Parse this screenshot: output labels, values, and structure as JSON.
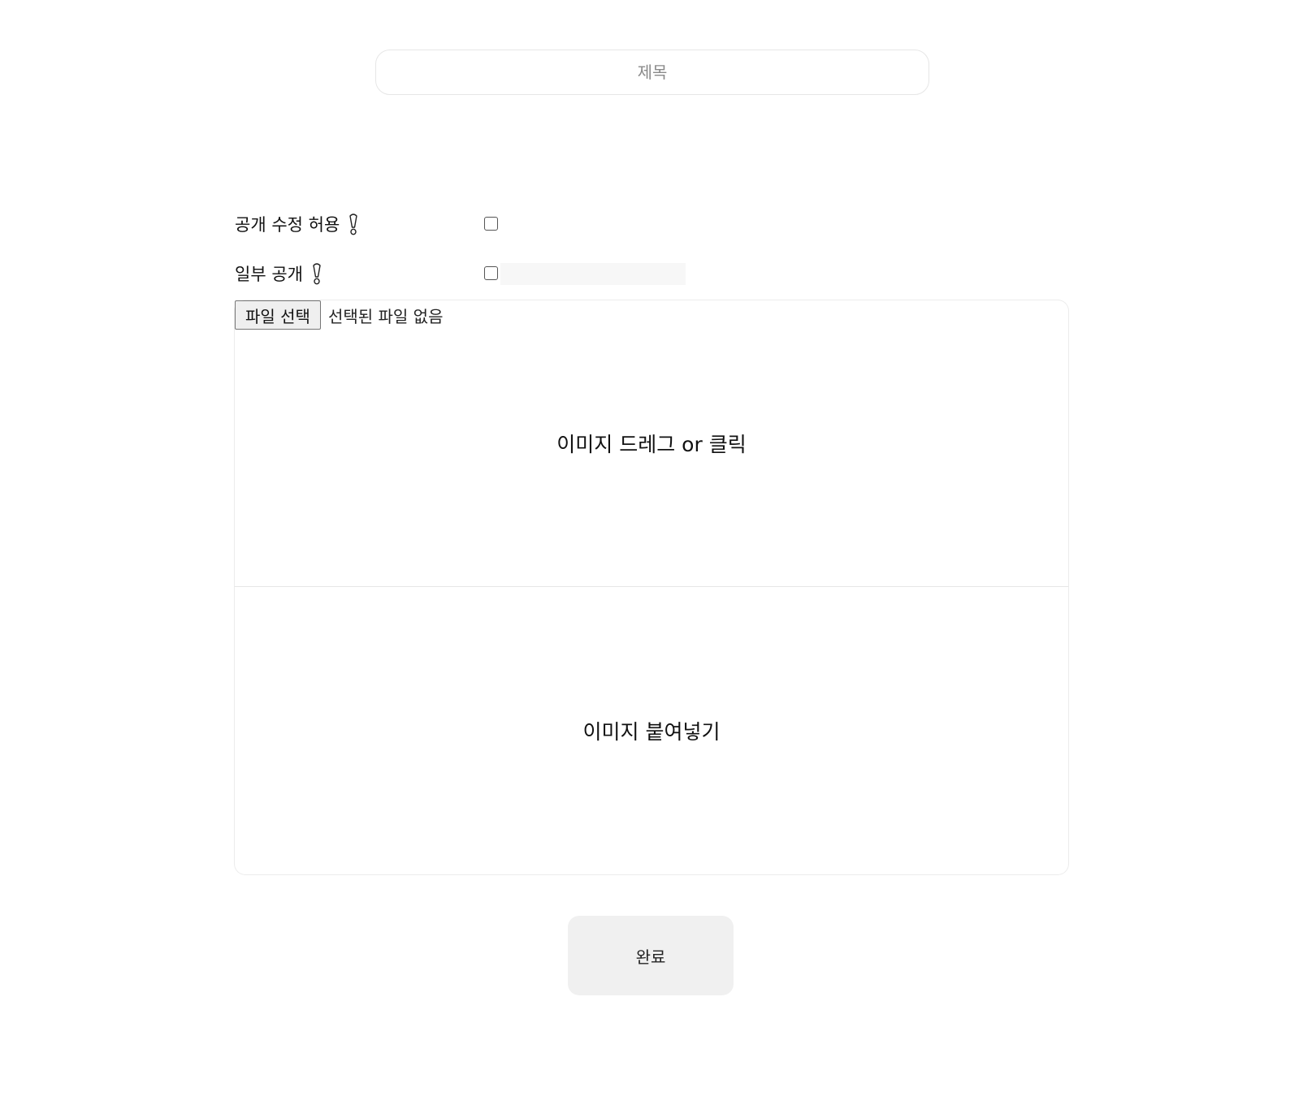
{
  "title_input": {
    "placeholder": "제목",
    "value": ""
  },
  "options": {
    "public_edit": {
      "label": "공개 수정 허용",
      "icon": "exclamation-hint-icon",
      "checked": false
    },
    "partial_public": {
      "label": "일부 공개",
      "icon": "exclamation-hint-icon",
      "checked": false,
      "field_value": ""
    }
  },
  "file_picker": {
    "button_label": "파일 선택",
    "status": "선택된 파일 없음"
  },
  "drop_zone": {
    "label": "이미지 드레그 or 클릭"
  },
  "paste_zone": {
    "label": "이미지 붙여넣기"
  },
  "submit": {
    "label": "완료"
  }
}
